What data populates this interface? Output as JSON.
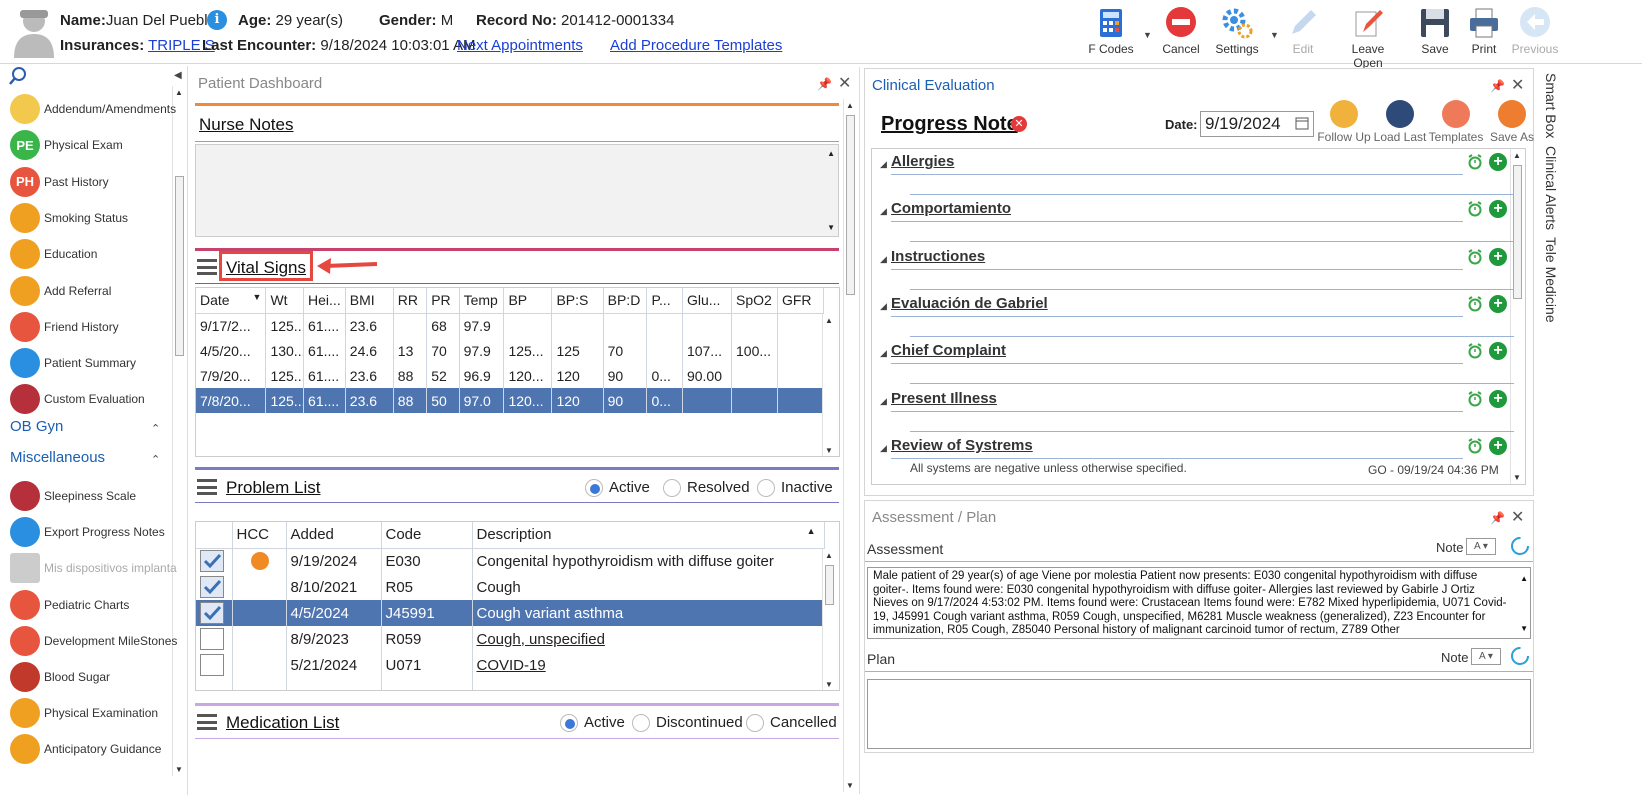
{
  "header": {
    "name_label": "Name:",
    "name": "Juan Del Pueblo",
    "age_label": "Age:",
    "age": "29 year(s)",
    "gender_label": "Gender:",
    "gender": "M",
    "record_label": "Record No:",
    "record": "201412-0001334",
    "insurances_label": "Insurances:",
    "insurance": "TRIPLE S",
    "last_encounter_label": "Last Encounter:",
    "last_encounter": "9/18/2024 10:03:01 AM",
    "next_appointments": "Next Appointments",
    "add_procedure_templates": "Add Procedure Templates"
  },
  "toolbar": {
    "fcodes": "F Codes",
    "cancel": "Cancel",
    "settings": "Settings",
    "edit": "Edit",
    "leave_open": "Leave Open",
    "save": "Save",
    "print": "Print",
    "previous": "Previous"
  },
  "sidebar": {
    "items": [
      {
        "label": "Addendum/Amendments",
        "icon": "document-icon"
      },
      {
        "label": "Physical Exam",
        "icon": "pe-icon",
        "abbr": "PE",
        "color": "#3ab54a"
      },
      {
        "label": "Past History",
        "icon": "ph-icon",
        "abbr": "PH",
        "color": "#e8553e"
      },
      {
        "label": "Smoking Status",
        "icon": "no-smoking-icon"
      },
      {
        "label": "Education",
        "icon": "education-icon"
      },
      {
        "label": "Add Referral",
        "icon": "referral-icon"
      },
      {
        "label": "Friend History",
        "icon": "friends-icon"
      },
      {
        "label": "Patient Summary",
        "icon": "folder-icon"
      },
      {
        "label": "Custom Evaluation",
        "icon": "stethoscope-icon"
      }
    ],
    "group_obgyn": "OB Gyn",
    "group_misc": "Miscellaneous",
    "misc_items": [
      {
        "label": "Sleepiness Scale",
        "icon": "bed-icon"
      },
      {
        "label": "Export Progress Notes",
        "icon": "export-icon"
      },
      {
        "label": "Mis dispositivos implanta",
        "icon": "device-icon"
      },
      {
        "label": "Pediatric Charts",
        "icon": "chart-icon"
      },
      {
        "label": "Development MileStones",
        "icon": "milestones-icon"
      },
      {
        "label": "Blood Sugar",
        "icon": "blood-icon"
      },
      {
        "label": "Physical Examination",
        "icon": "clipboard-icon"
      },
      {
        "label": "Anticipatory Guidance",
        "icon": "guidance-icon"
      }
    ]
  },
  "dashboard": {
    "title": "Patient Dashboard",
    "nurse_notes": "Nurse Notes",
    "vital_signs": "Vital Signs",
    "vitals_headers": [
      "Date",
      "Wt",
      "Hei...",
      "BMI",
      "RR",
      "PR",
      "Temp",
      "BP",
      "BP:S",
      "BP:D",
      "P...",
      "Glu...",
      "SpO2",
      "GFR"
    ],
    "vitals_rows": [
      [
        "9/17/2...",
        "125...",
        "61....",
        "23.6",
        "",
        "68",
        "97.9",
        "",
        "",
        "",
        "",
        "",
        "",
        ""
      ],
      [
        "4/5/20...",
        "130...",
        "61....",
        "24.6",
        "13",
        "70",
        "97.9",
        "125...",
        "125",
        "70",
        "",
        "107...",
        "100...",
        ""
      ],
      [
        "7/9/20...",
        "125...",
        "61....",
        "23.6",
        "88",
        "52",
        "96.9",
        "120...",
        "120",
        "90",
        "0...",
        "90.00",
        "",
        ""
      ],
      [
        "7/8/20...",
        "125...",
        "61....",
        "23.6",
        "88",
        "50",
        "97.0",
        "120...",
        "120",
        "90",
        "0...",
        "",
        "",
        ""
      ]
    ],
    "problem_list": "Problem List",
    "problem_filters": [
      "Active",
      "Resolved",
      "Inactive"
    ],
    "problem_headers": [
      "",
      "HCC",
      "Added",
      "Code",
      "Description"
    ],
    "problem_rows": [
      {
        "checked": true,
        "hcc": true,
        "added": "9/19/2024",
        "code": "E030",
        "desc": "Congenital hypothyroidism with diffuse goiter",
        "link": false
      },
      {
        "checked": true,
        "hcc": false,
        "added": "8/10/2021",
        "code": "R05",
        "desc": "Cough",
        "link": false
      },
      {
        "checked": true,
        "hcc": false,
        "added": "4/5/2024",
        "code": "J45991",
        "desc": "Cough variant asthma",
        "link": false
      },
      {
        "checked": false,
        "hcc": false,
        "added": "8/9/2023",
        "code": "R059",
        "desc": "Cough, unspecified",
        "link": true
      },
      {
        "checked": false,
        "hcc": false,
        "added": "5/21/2024",
        "code": "U071",
        "desc": "COVID-19",
        "link": true
      }
    ],
    "medication_list": "Medication List",
    "med_filters": [
      "Active",
      "Discontinued",
      "Cancelled"
    ]
  },
  "clinical": {
    "title": "Clinical Evaluation",
    "note_title": "Progress Note",
    "date_label": "Date:",
    "date": "9/19/2024",
    "buttons": [
      "Follow Up",
      "Load Last",
      "Templates",
      "Save As"
    ],
    "sections": [
      "Allergies",
      "Comportamiento",
      "Instructiones",
      "Evaluación de Gabriel",
      "Chief Complaint",
      "Present Illness",
      "Review of Systrems"
    ],
    "ros_text": "All systems are negative unless otherwise specified.",
    "ros_sign": "GO - 09/19/24 04:36 PM"
  },
  "side_tabs": [
    "Smart Box",
    "Clinical Alerts",
    "Tele Medicine"
  ],
  "assessment": {
    "title": "Assessment / Plan",
    "assessment_label": "Assessment",
    "note_label": "Note",
    "text": "Male patient of 29 year(s) of age Viene por molestia Patient now presents: E030 congenital hypothyroidism with diffuse goiter-. Items found were: E030 congenital hypothyroidism with diffuse goiter-   Allergies last reviewed by Gabirle J Ortiz Nieves on 9/17/2024 4:53:02 PM.    Items found were:  Crustacean  Items found were:  E782 Mixed hyperlipidemia, U071 Covid-19, J45991 Cough variant asthma, R059 Cough, unspecified, M6281 Muscle weakness (generalized), Z23 Encounter for immunization, R05 Cough, Z85040 Personal history of malignant carcinoid tumor of rectum, Z789 Other",
    "plan_label": "Plan"
  }
}
